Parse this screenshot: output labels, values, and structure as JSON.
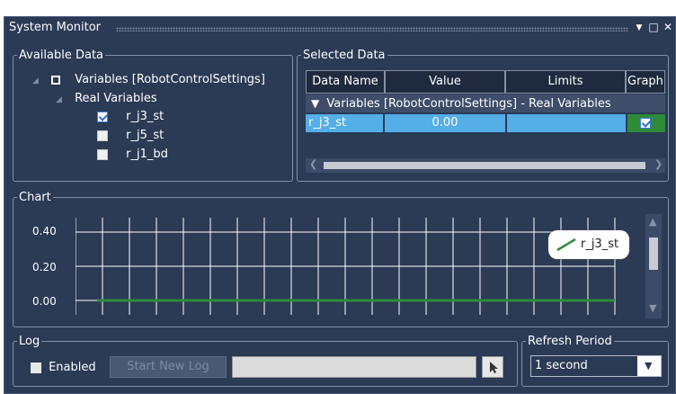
{
  "window": {
    "title": "System Monitor"
  },
  "available_data": {
    "legend": "Available Data",
    "root": {
      "label": "Variables [RobotControlSettings]"
    },
    "group": {
      "label": "Real Variables"
    },
    "items": [
      {
        "label": "r_j3_st",
        "checked": true
      },
      {
        "label": "r_j5_st",
        "checked": false
      },
      {
        "label": "r_j1_bd",
        "checked": false
      }
    ]
  },
  "selected_data": {
    "legend": "Selected Data",
    "columns": [
      "Data Name",
      "Value",
      "Limits",
      "Graph"
    ],
    "group_row": "Variables [RobotControlSettings] - Real Variables",
    "rows": [
      {
        "name": "r_j3_st",
        "value": "0.00",
        "limits": "",
        "graph": true
      }
    ]
  },
  "chart": {
    "legend": "Chart",
    "chart_data": {
      "type": "line",
      "title": "",
      "xlabel": "",
      "ylabel": "",
      "ylim": [
        0.0,
        0.4
      ],
      "yticks": [
        "0.40",
        "0.20",
        "0.00"
      ],
      "grid": true,
      "legend_position": "top-right",
      "series": [
        {
          "name": "r_j3_st",
          "color": "#2e8b3a",
          "values": [
            0,
            0,
            0,
            0,
            0,
            0,
            0,
            0,
            0,
            0,
            0,
            0,
            0,
            0,
            0,
            0,
            0,
            0,
            0,
            0,
            0,
            0,
            0,
            0,
            0,
            0,
            0,
            0,
            0,
            0,
            0,
            0,
            0,
            0,
            0,
            0,
            0,
            0,
            0,
            0
          ]
        }
      ]
    }
  },
  "log": {
    "legend": "Log",
    "enabled_label": "Enabled",
    "enabled": false,
    "start_button": "Start New Log",
    "path_value": ""
  },
  "refresh": {
    "legend": "Refresh Period",
    "selected": "1 second"
  },
  "colors": {
    "background": "#2b3a55",
    "selection": "#54aee8",
    "series": "#2e8b3a"
  }
}
